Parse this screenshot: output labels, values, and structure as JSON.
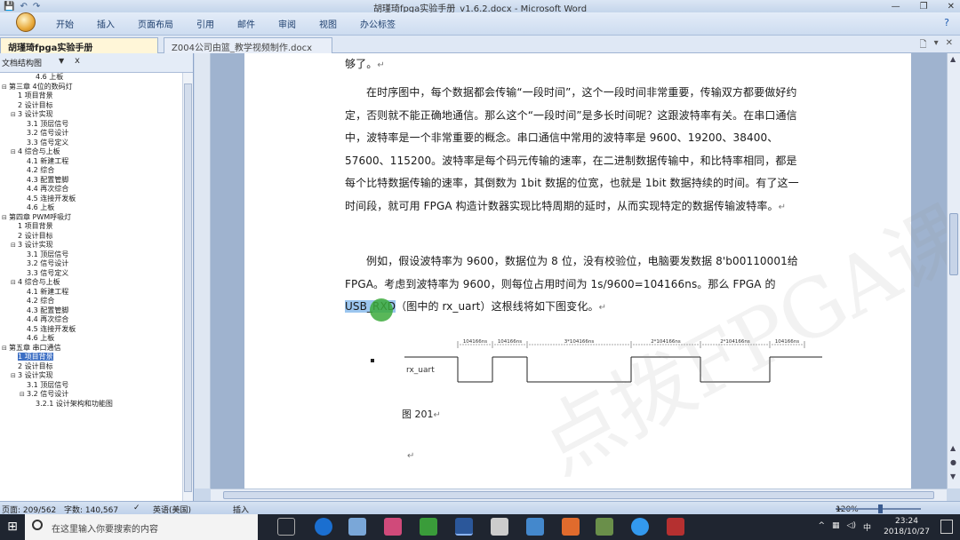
{
  "window": {
    "title": "胡瑾琦fpga实验手册_v1.6.2.docx - Microsoft Word",
    "help_icon": "help-icon"
  },
  "ribbon": {
    "tabs": [
      "开始",
      "插入",
      "页面布局",
      "引用",
      "邮件",
      "审阅",
      "视图",
      "办公标签"
    ]
  },
  "doc_tabs": [
    {
      "label": "胡瑾琦fpga实验手册_v1.6.2.docx",
      "close": "×",
      "active": true
    },
    {
      "label": "Z004公司由篮_教学视频制作.docx",
      "close": "",
      "active": false
    }
  ],
  "nav_pane": {
    "header": "文档结构图",
    "dropdown": "▼",
    "close": "x",
    "items": [
      {
        "level": 3,
        "text": "4.6 上板",
        "toggle": ""
      },
      {
        "level": 0,
        "text": "第三章 4位的数码灯",
        "toggle": "⊟"
      },
      {
        "level": 1,
        "text": "1 项目背景",
        "toggle": ""
      },
      {
        "level": 1,
        "text": "2 设计目标",
        "toggle": ""
      },
      {
        "level": 1,
        "text": "3 设计实现",
        "toggle": "⊟"
      },
      {
        "level": 2,
        "text": "3.1 顶层信号",
        "toggle": ""
      },
      {
        "level": 2,
        "text": "3.2 信号设计",
        "toggle": ""
      },
      {
        "level": 2,
        "text": "3.3 信号定义",
        "toggle": ""
      },
      {
        "level": 1,
        "text": "4 综合与上板",
        "toggle": "⊟"
      },
      {
        "level": 2,
        "text": "4.1 新建工程",
        "toggle": ""
      },
      {
        "level": 2,
        "text": "4.2 综合",
        "toggle": ""
      },
      {
        "level": 2,
        "text": "4.3 配置管脚",
        "toggle": ""
      },
      {
        "level": 2,
        "text": "4.4 再次综合",
        "toggle": ""
      },
      {
        "level": 2,
        "text": "4.5 连接开发板",
        "toggle": ""
      },
      {
        "level": 2,
        "text": "4.6 上板",
        "toggle": ""
      },
      {
        "level": 0,
        "text": "第四章 PWM呼吸灯",
        "toggle": "⊟"
      },
      {
        "level": 1,
        "text": "1 项目背景",
        "toggle": ""
      },
      {
        "level": 1,
        "text": "2 设计目标",
        "toggle": ""
      },
      {
        "level": 1,
        "text": "3 设计实现",
        "toggle": "⊟"
      },
      {
        "level": 2,
        "text": "3.1 顶层信号",
        "toggle": ""
      },
      {
        "level": 2,
        "text": "3.2 信号设计",
        "toggle": ""
      },
      {
        "level": 2,
        "text": "3.3 信号定义",
        "toggle": ""
      },
      {
        "level": 1,
        "text": "4 综合与上板",
        "toggle": "⊟"
      },
      {
        "level": 2,
        "text": "4.1 新建工程",
        "toggle": ""
      },
      {
        "level": 2,
        "text": "4.2 综合",
        "toggle": ""
      },
      {
        "level": 2,
        "text": "4.3 配置管脚",
        "toggle": ""
      },
      {
        "level": 2,
        "text": "4.4 再次综合",
        "toggle": ""
      },
      {
        "level": 2,
        "text": "4.5 连接开发板",
        "toggle": ""
      },
      {
        "level": 2,
        "text": "4.6 上板",
        "toggle": ""
      },
      {
        "level": 0,
        "text": "第五章 串口通信",
        "toggle": "⊟"
      },
      {
        "level": 1,
        "text": "1 项目背景",
        "toggle": "",
        "selected": true
      },
      {
        "level": 1,
        "text": "2 设计目标",
        "toggle": ""
      },
      {
        "level": 1,
        "text": "3 设计实现",
        "toggle": "⊟"
      },
      {
        "level": 2,
        "text": "3.1 顶层信号",
        "toggle": ""
      },
      {
        "level": 2,
        "text": "3.2 信号设计",
        "toggle": "⊟"
      },
      {
        "level": 3,
        "text": "3.2.1 设计架构和功能图",
        "toggle": ""
      }
    ]
  },
  "document": {
    "p0": "够了。",
    "p1": "在时序图中，每个数据都会传输“一段时间”，这个一段时间非常重要，传输双方都要做好约定，否则就不能正确地通信。那么这个“一段时间”是多长时间呢？这跟波特率有关。在串口通信中，波特率是一个非常重要的概念。串口通信中常用的波特率是 9600、19200、38400、57600、115200。波特率是每个码元传输的速率，在二进制数据传输中，和比特率相同，都是每个比特数据传输的速率，其倒数为 1bit 数据的位宽，也就是 1bit 数据持续的时间。有了这一时间段，就可用 FPGA 构造计数器实现比特周期的延时，从而实现特定的数据传输波特率。",
    "p2_before": "例如，假设波特率为 9600，数据位为 8 位，没有校验位，电脑要发数据 8'b00110001给 FPGA。考虑到波特率为 9600，则每位占用时间为 1s/9600=104166ns。那么 FPGA 的 ",
    "p2_highlight": "USB_RXD",
    "p2_after": "（图中的 rx_uart）这根线将如下图变化。",
    "para_mark": "↵",
    "figure_caption": "图 201",
    "watermark": "点拨FPGA课程"
  },
  "timing": {
    "signal": "rx_uart",
    "segments": [
      {
        "label": "104166ns",
        "level": "low",
        "bits": 1
      },
      {
        "label": "104166ns",
        "level": "high",
        "bits": 1
      },
      {
        "label": "3*104166ns",
        "level": "low",
        "bits": 3
      },
      {
        "label": "2*104166ns",
        "level": "high",
        "bits": 2
      },
      {
        "label": "2*104166ns",
        "level": "low",
        "bits": 2
      },
      {
        "label": "104166ns",
        "level": "high",
        "bits": 1
      }
    ]
  },
  "status_bar": {
    "page": "页面: 209/562",
    "words": "字数: 140,567",
    "lang": "英语(美国)",
    "mode": "插入",
    "zoom": "120%"
  },
  "taskbar": {
    "search_placeholder": "在这里输入你要搜索的内容",
    "time": "23:24",
    "date": "2018/10/27",
    "ime": "中"
  }
}
